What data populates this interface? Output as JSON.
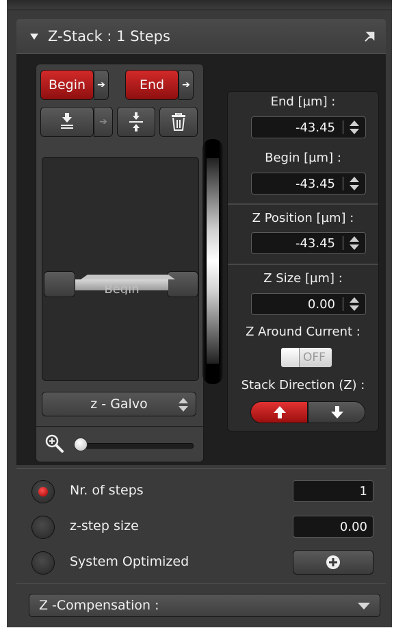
{
  "panel": {
    "title": "Z-Stack : 1 Steps"
  },
  "controls": {
    "begin_label": "Begin",
    "end_label": "End",
    "preview_begin_label": "Begin",
    "drive_select": "z - Galvo"
  },
  "fields": {
    "end_label": "End [µm] :",
    "end_value": "-43.45",
    "begin_label": "Begin [µm] :",
    "begin_value": "-43.45",
    "zpos_label": "Z Position [µm] :",
    "zpos_value": "-43.45",
    "zsize_label": "Z Size [µm] :",
    "zsize_value": "0.00",
    "around_label": "Z Around Current :",
    "around_toggle": "OFF",
    "direction_label": "Stack Direction (Z) :"
  },
  "options": {
    "nr_steps_label": "Nr. of steps",
    "nr_steps_value": "1",
    "step_size_label": "z-step size",
    "step_size_value": "0.00",
    "optimized_label": "System Optimized"
  },
  "compensation": {
    "label": "Z -Compensation :"
  },
  "colors": {
    "accent_red": "#b81818",
    "panel_bg": "#3a3a3a",
    "field_bg": "#151515"
  }
}
